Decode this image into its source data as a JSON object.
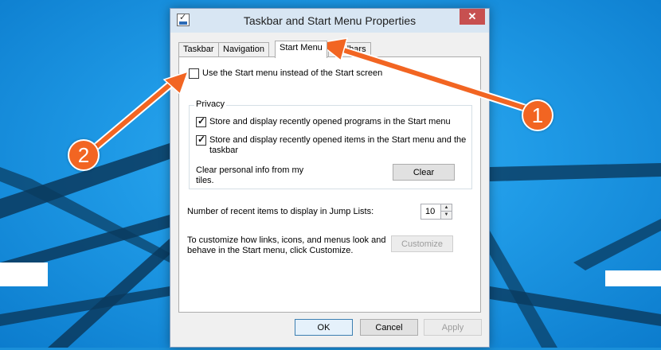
{
  "window": {
    "title": "Taskbar and Start Menu Properties",
    "close_glyph": "✕"
  },
  "tabs": [
    {
      "label": "Taskbar",
      "active": false
    },
    {
      "label": "Navigation",
      "active": false
    },
    {
      "label": "Start Menu",
      "active": true
    },
    {
      "label": "Toolbars",
      "active": false
    }
  ],
  "start_menu": {
    "use_start_menu_label": "Use the Start menu instead of the Start screen",
    "use_start_menu_checked": false,
    "privacy": {
      "title": "Privacy",
      "store_programs_label": "Store and display recently opened programs in the Start menu",
      "store_programs_checked": true,
      "store_items_label_line1": "Store and display recently opened items in the Start menu and the",
      "store_items_label_line2": "taskbar",
      "store_items_checked": true,
      "clear_info_line1": "Clear personal info from my",
      "clear_info_line2": "tiles.",
      "clear_button": "Clear"
    },
    "jump_lists": {
      "label": "Number of recent items to display in Jump Lists:",
      "value": "10"
    },
    "customize": {
      "text_line1": "To customize how links, icons, and menus look and",
      "text_line2": "behave in the Start menu, click Customize.",
      "button": "Customize"
    }
  },
  "footer": {
    "ok": "OK",
    "cancel": "Cancel",
    "apply": "Apply"
  },
  "annotations": {
    "callout_1": "1",
    "callout_2": "2",
    "accent_color": "#f26522"
  }
}
